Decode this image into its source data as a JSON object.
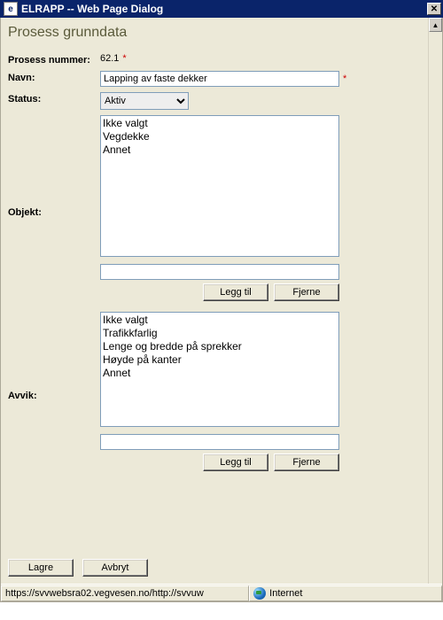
{
  "window": {
    "title": "ELRAPP -- Web Page Dialog",
    "icon_glyph": "e"
  },
  "page": {
    "title": "Prosess grunndata"
  },
  "fields": {
    "prosess_nummer_label": "Prosess nummer:",
    "prosess_nummer_value": "62.1",
    "navn_label": "Navn:",
    "navn_value": "Lapping av faste dekker",
    "status_label": "Status:",
    "status_value": "Aktiv",
    "objekt_label": "Objekt:",
    "avvik_label": "Avvik:"
  },
  "objekt": {
    "items": [
      "Ikke valgt",
      "Vegdekke",
      "Annet"
    ],
    "input_value": "",
    "add_label": "Legg til",
    "remove_label": "Fjerne"
  },
  "avvik": {
    "items": [
      "Ikke valgt",
      "Trafikkfarlig",
      "Lenge og bredde på sprekker",
      "Høyde på kanter",
      "Annet"
    ],
    "input_value": "",
    "add_label": "Legg til",
    "remove_label": "Fjerne"
  },
  "actions": {
    "save": "Lagre",
    "cancel": "Avbryt"
  },
  "statusbar": {
    "url": "https://svvwebsra02.vegvesen.no/http://svvuw",
    "zone": "Internet"
  }
}
